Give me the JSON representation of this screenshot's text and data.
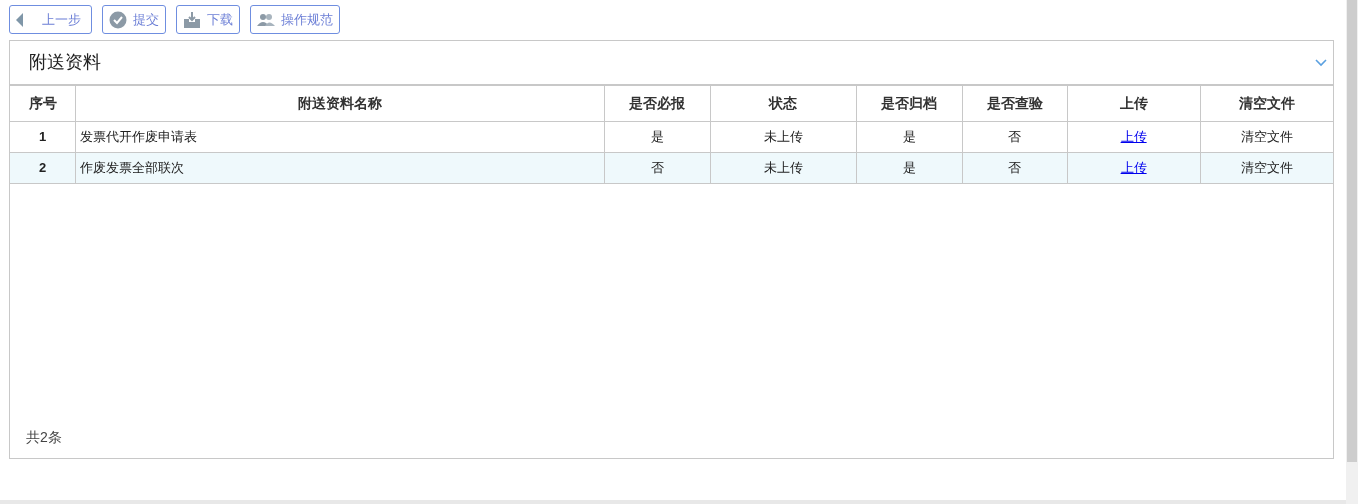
{
  "toolbar": [
    {
      "kind": "back",
      "label": "上一步"
    },
    {
      "kind": "submit",
      "label": "提交"
    },
    {
      "kind": "download",
      "label": "下载"
    },
    {
      "kind": "guide",
      "label": "操作规范"
    }
  ],
  "panel": {
    "title": "附送资料",
    "expanded": true,
    "table": {
      "columns": [
        "序号",
        "附送资料名称",
        "是否必报",
        "状态",
        "是否归档",
        "是否查验",
        "上传",
        "清空文件"
      ],
      "rows": [
        {
          "selected": false,
          "cells": [
            "1",
            "发票代开作废申请表",
            "是",
            "未上传",
            "是",
            "否",
            "上传",
            "清空文件"
          ]
        },
        {
          "selected": true,
          "cells": [
            "2",
            "作废发票全部联次",
            "否",
            "未上传",
            "是",
            "否",
            "上传",
            "清空文件"
          ]
        }
      ]
    },
    "footer": "共2条"
  }
}
